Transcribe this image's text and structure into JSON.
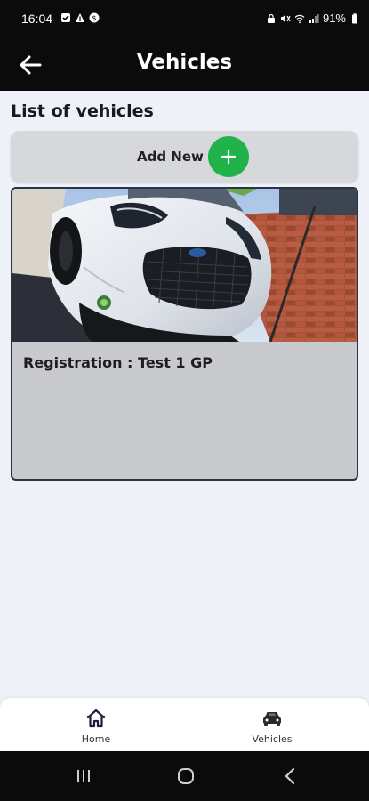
{
  "status_bar": {
    "time": "16:04",
    "battery": "91%"
  },
  "app_bar": {
    "title": "Vehicles",
    "back_icon": "arrow-left-icon"
  },
  "content": {
    "heading": "List of vehicles",
    "add_new_label": "Add New",
    "add_icon": "plus-icon",
    "vehicles": [
      {
        "registration": "Registration : Test 1 GP"
      }
    ]
  },
  "bottom_nav": {
    "items": [
      {
        "label": "Home",
        "icon": "home-icon"
      },
      {
        "label": "Vehicles",
        "icon": "car-icon"
      }
    ]
  },
  "colors": {
    "accent_green": "#21b34a",
    "bar_black": "#0b0b0b",
    "background": "#eef1f7"
  }
}
